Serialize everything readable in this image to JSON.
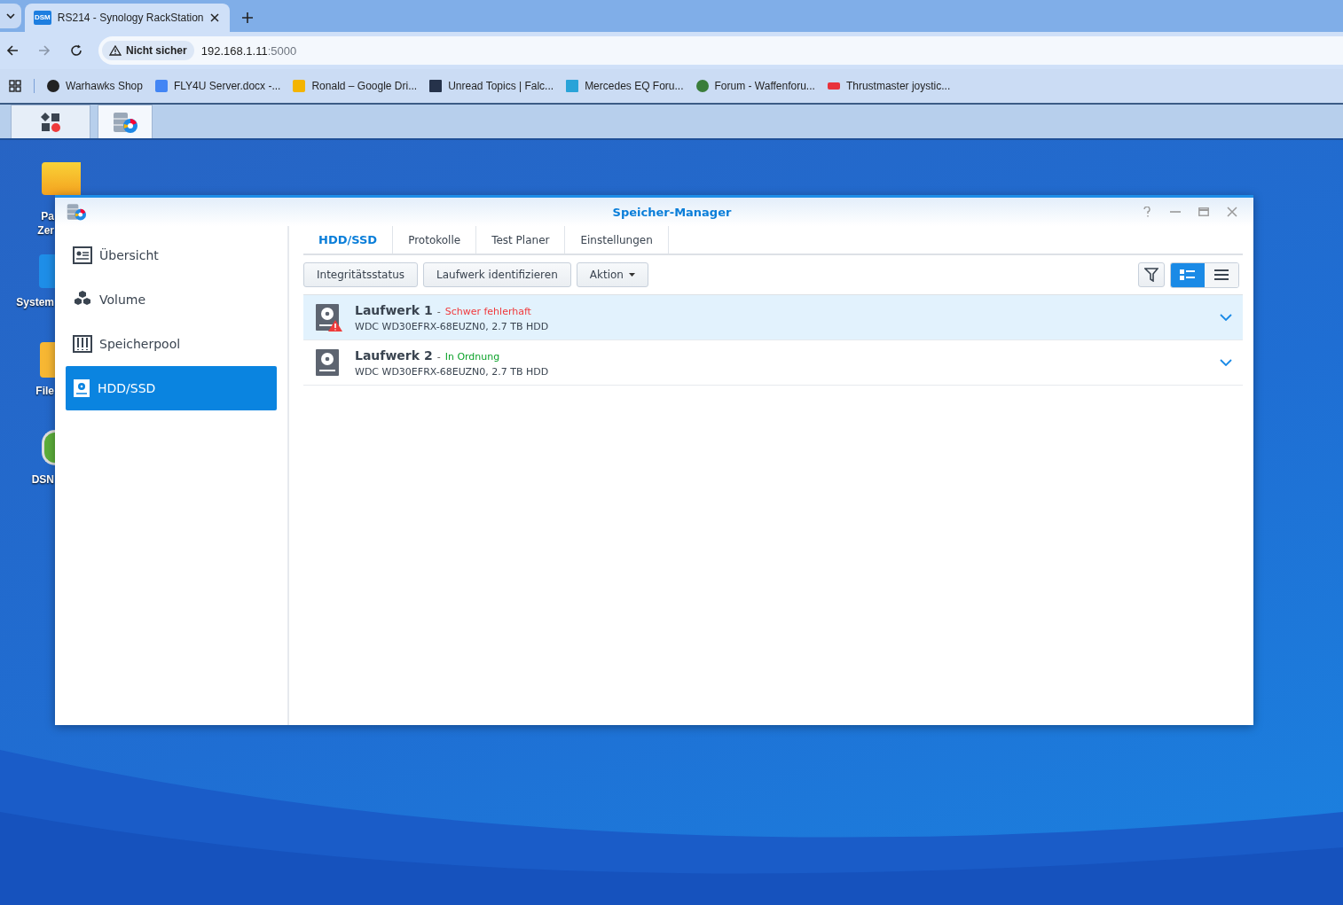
{
  "browser": {
    "tabs": [
      {
        "title": "RS214 - Synology RackStation",
        "favicon": "DSM",
        "selected": true
      }
    ],
    "security_label": "Nicht sicher",
    "url_host": "192.168.1.11",
    "url_port": ":5000",
    "bookmarks": [
      {
        "label": "Warhawks Shop"
      },
      {
        "label": "FLY4U Server.docx -..."
      },
      {
        "label": "Ronald – Google Dri..."
      },
      {
        "label": "Unread Topics | Falc..."
      },
      {
        "label": "Mercedes EQ Foru..."
      },
      {
        "label": "Forum - Waffenforu..."
      },
      {
        "label": "Thrustmaster joystic..."
      }
    ]
  },
  "taskbar": {
    "items": [
      {
        "selected": false
      },
      {
        "selected": true
      }
    ]
  },
  "desktop": {
    "icons": [
      {
        "lines": [
          "Pa",
          "Zer"
        ]
      },
      {
        "lines": [
          "System"
        ]
      },
      {
        "lines": [
          "File"
        ]
      },
      {
        "lines": [
          "DSN"
        ]
      }
    ]
  },
  "window": {
    "title": "Speicher-Manager",
    "sidebar": [
      {
        "label": "Übersicht",
        "selected": false
      },
      {
        "label": "Volume",
        "selected": false
      },
      {
        "label": "Speicherpool",
        "selected": false
      },
      {
        "label": "HDD/SSD",
        "selected": true
      }
    ],
    "tabs": [
      {
        "label": "HDD/SSD",
        "selected": true
      },
      {
        "label": "Protokolle",
        "selected": false
      },
      {
        "label": "Test Planer",
        "selected": false
      },
      {
        "label": "Einstellungen",
        "selected": false
      }
    ],
    "toolbar": [
      "Integritätsstatus",
      "Laufwerk identifizieren",
      "Aktion"
    ],
    "view_modes": [
      {
        "selected": true
      },
      {
        "selected": false
      }
    ],
    "drives": [
      {
        "name": "Laufwerk 1",
        "separator": "-",
        "status": "Schwer fehlerhaft",
        "kind": "error",
        "detail": "WDC WD30EFRX-68EUZN0, 2.7 TB HDD",
        "selected": true
      },
      {
        "name": "Laufwerk 2",
        "separator": "-",
        "status": "In Ordnung",
        "kind": "ok",
        "detail": "WDC WD30EFRX-68EUZN0, 2.7 TB HDD",
        "selected": false
      }
    ]
  }
}
